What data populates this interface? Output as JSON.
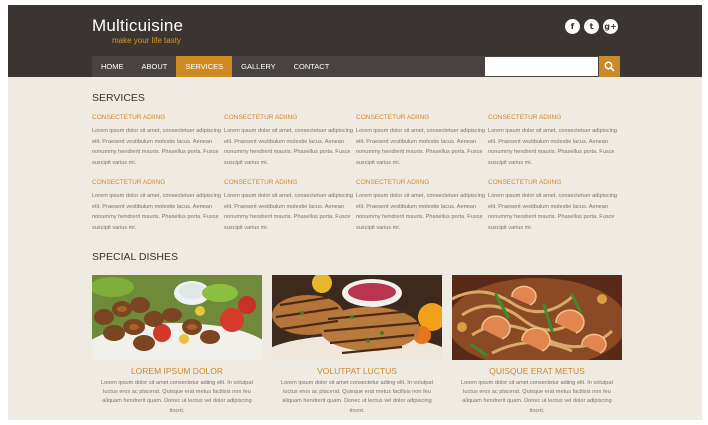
{
  "header": {
    "logo_title": "Multicuisine",
    "logo_tagline": "make your life tasty",
    "social": [
      {
        "name": "facebook-icon",
        "glyph": "f"
      },
      {
        "name": "twitter-icon",
        "glyph": "t"
      },
      {
        "name": "google-plus-icon",
        "glyph": "g+"
      }
    ]
  },
  "nav": {
    "items": [
      "HOME",
      "ABOUT",
      "SERVICES",
      "GALLERY",
      "CONTACT"
    ],
    "active": "SERVICES",
    "search_value": ""
  },
  "services": {
    "title": "SERVICES",
    "items": [
      {
        "heading": "CONSECTETUR ADIING",
        "text": "Lorem ipsum dolor sit amet, consectetuer adipiscing elit. Praesent vestibulum molestie lacus. Aenean nonummy hendrerit mauris. Phasellus porta. Fusce suscipit varius mi."
      },
      {
        "heading": "CONSECTETUR ADIING",
        "text": "Lorem ipsum dolor sit amet, consectetuer adipiscing elit. Praesent vestibulum molestie lacus. Aenean nonummy hendrerit mauris. Phasellus porta. Fusce suscipit varius mi."
      },
      {
        "heading": "CONSECTETUR ADIING",
        "text": "Lorem ipsum dolor sit amet, consectetuer adipiscing elit. Praesent vestibulum molestie lacus. Aenean nonummy hendrerit mauris. Phasellus porta. Fusce suscipit varius mi."
      },
      {
        "heading": "CONSECTETUR ADIING",
        "text": "Lorem ipsum dolor sit amet, consectetuer adipiscing elit. Praesent vestibulum molestie lacus. Aenean nonummy hendrerit mauris. Phasellus porta. Fusce suscipit varius mi."
      },
      {
        "heading": "CONSECTETUR ADIING",
        "text": "Lorem ipsum dolor sit amet, consectetuer adipiscing elit. Praesent vestibulum molestie lacus. Aenean nonummy hendrerit mauris. Phasellus porta. Fusce suscipit varius mi."
      },
      {
        "heading": "CONSECTETUR ADIING",
        "text": "Lorem ipsum dolor sit amet, consectetuer adipiscing elit. Praesent vestibulum molestie lacus. Aenean nonummy hendrerit mauris. Phasellus porta. Fusce suscipit varius mi."
      },
      {
        "heading": "CONSECTETUR ADIING",
        "text": "Lorem ipsum dolor sit amet, consectetuer adipiscing elit. Praesent vestibulum molestie lacus. Aenean nonummy hendrerit mauris. Phasellus porta. Fusce suscipit varius mi."
      },
      {
        "heading": "CONSECTETUR ADIING",
        "text": "Lorem ipsum dolor sit amet, consectetuer adipiscing elit. Praesent vestibulum molestie lacus. Aenean nonummy hendrerit mauris. Phasellus porta. Fusce suscipit varius mi."
      }
    ]
  },
  "dishes": {
    "title": "SPECIAL DISHES",
    "items": [
      {
        "title": "LOREM IPSUM DOLOR",
        "text": "Lorem ipsum dolor sit amet consectetur adiing elit. In volutpat luctus eros ac placerat. Quisque erat metus facilisis non feu aliquam hendrerit quam. Donec ut lectus vel dolor adipiscing tincnt."
      },
      {
        "title": "VOLUTPAT LUCTUS",
        "text": "Lorem ipsum dolor sit amet consectetur adiing elit. In volutpat luctus eros ac placerat. Quisque erat metus facilisis non feu aliquam hendrerit quam. Donec ut lectus vel dolor adipiscing tincnt."
      },
      {
        "title": "QUISQUE ERAT METUS",
        "text": "Lorem ipsum dolor sit amet consectetur adiing elit. In volutpat luctus eros ac placerat. Quisque erat metus facilisis non feu aliquam hendrerit quam. Donec ut lectus vel dolor adipiscing tincnt."
      }
    ]
  },
  "colors": {
    "header_bg": "#3a3433",
    "nav_bg": "#484242",
    "accent": "#c98a2c",
    "page_bg": "#f0ebe2"
  }
}
